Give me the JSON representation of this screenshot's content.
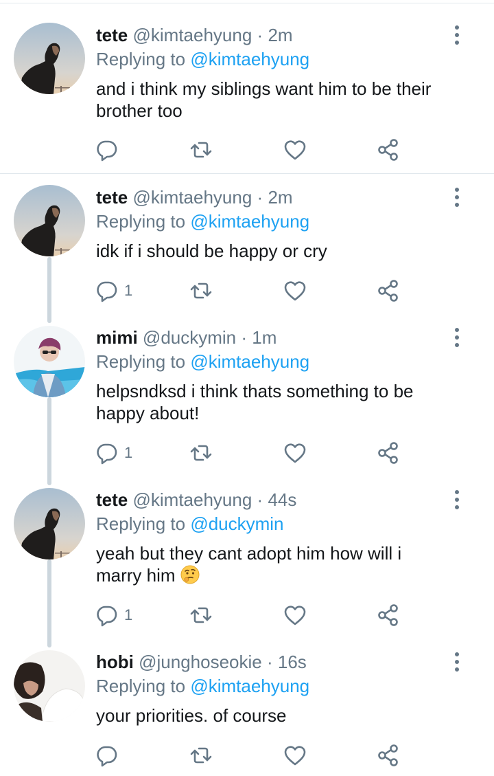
{
  "tweets": [
    {
      "name": "tete",
      "handle": "@kimtaehyung",
      "time": "2m",
      "reply_prefix": "Replying to",
      "reply_to": "@kimtaehyung",
      "text": "and i think my siblings want him to be their\nbrother too",
      "reply_count": "",
      "avatar": "tete-avatar"
    },
    {
      "name": "tete",
      "handle": "@kimtaehyung",
      "time": "2m",
      "reply_prefix": "Replying to",
      "reply_to": "@kimtaehyung",
      "text": "idk if i should be happy or cry",
      "reply_count": "1",
      "avatar": "tete-avatar"
    },
    {
      "name": "mimi",
      "handle": "@duckymin",
      "time": "1m",
      "reply_prefix": "Replying to",
      "reply_to": "@kimtaehyung",
      "text": "helpsndksd i think thats something to be\nhappy about!",
      "reply_count": "1",
      "avatar": "mimi-avatar"
    },
    {
      "name": "tete",
      "handle": "@kimtaehyung",
      "time": "44s",
      "reply_prefix": "Replying to",
      "reply_to": "@duckymin",
      "text": "yeah but they cant adopt him how will i\nmarry him",
      "reply_count": "1",
      "avatar": "tete-avatar"
    },
    {
      "name": "hobi",
      "handle": "@junghoseokie",
      "time": "16s",
      "reply_prefix": "Replying to",
      "reply_to": "@kimtaehyung",
      "text": "your priorities. of course",
      "reply_count": "",
      "avatar": "hobi-avatar"
    }
  ],
  "separator_dot": "·",
  "colors": {
    "mention": "#1da1f2",
    "secondary": "#657786",
    "thread_line": "#ccd6dd",
    "divider": "#e1e8ed"
  }
}
